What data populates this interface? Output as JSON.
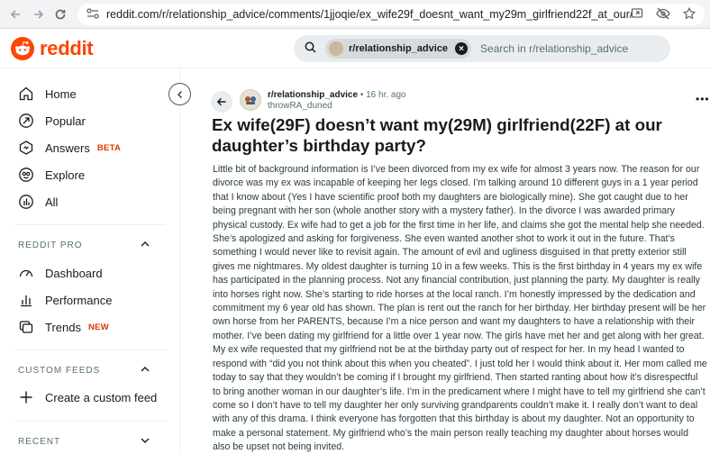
{
  "browser": {
    "url": "reddit.com/r/relationship_advice/comments/1jjoqie/ex_wife29f_doesnt_want_my29m_girlfriend22f_at_our/"
  },
  "header": {
    "logo_text": "reddit",
    "brand_color": "#ff4500",
    "search": {
      "chip_label": "r/relationship_advice",
      "placeholder": "Search in r/relationship_advice"
    }
  },
  "sidebar": {
    "main_items": [
      {
        "label": "Home",
        "icon": "home-icon"
      },
      {
        "label": "Popular",
        "icon": "popular-icon"
      },
      {
        "label": "Answers",
        "icon": "answers-icon",
        "tag": "BETA"
      },
      {
        "label": "Explore",
        "icon": "explore-icon"
      },
      {
        "label": "All",
        "icon": "all-icon"
      }
    ],
    "reddit_pro": {
      "title": "REDDIT PRO",
      "items": [
        {
          "label": "Dashboard",
          "icon": "dashboard-icon"
        },
        {
          "label": "Performance",
          "icon": "performance-icon"
        },
        {
          "label": "Trends",
          "icon": "trends-icon",
          "tag": "NEW"
        }
      ]
    },
    "custom_feeds": {
      "title": "CUSTOM FEEDS",
      "items": [
        {
          "label": "Create a custom feed",
          "icon": "plus-icon"
        }
      ]
    },
    "recent": {
      "title": "RECENT"
    }
  },
  "post": {
    "subreddit": "r/relationship_advice",
    "age": "• 16 hr. ago",
    "author": "throwRA_duned",
    "title": "Ex wife(29F) doesn’t want my(29M) girlfriend(22F) at our daughter’s birthday party?",
    "body": "Little bit of background information is I’ve been divorced from my ex wife for almost 3 years now. The reason for our divorce was my ex was incapable of keeping her legs closed. I’m talking around 10 different guys in a 1 year period that I know about (Yes I have scientific proof both my daughters are biologically mine). She got caught due to her being pregnant with her son (whole another story with a mystery father). In the divorce I was awarded primary physical custody. Ex wife had to get a job for the first time in her life, and claims she got the mental help she needed. She’s apologized and asking for forgiveness. She even wanted another shot to work it out in the future. That’s something I would never like to revisit again. The amount of evil and ugliness disguised in that pretty exterior still gives me nightmares. My oldest daughter is turning 10 in a few weeks. This is the first birthday in 4 years my ex wife has participated in the planning process. Not any financial contribution, just planning the party. My daughter is really into horses right now. She’s starting to ride horses at the local ranch. I’m honestly impressed by the dedication and commitment my 6 year old has shown. The plan is rent out the ranch for her birthday. Her birthday present will be her own horse from her PARENTS, because I’m a nice person and want my daughters to have a relationship with their mother. I’ve been dating my girlfriend for a little over 1 year now. The girls have met her and get along with her great. My ex wife requested that my girlfriend not be at the birthday party out of respect for her. In my head I wanted to respond with “did you not think about this when you cheated”. I just told her I would think about it. Her mom called me today to say that they wouldn’t be coming if I brought my girlfriend. Then started ranting about how it’s disrespectful to bring another woman in our daughter’s life. I’m in the predicament where I might have to tell my girlfriend she can’t come so I don’t have to tell my daughter her only surviving grandparents couldn’t make it. I really don’t want to deal with any of this drama. I think everyone has forgotten that this birthday is about my daughter. Not an opportunity to make a personal statement. My girlfriend who’s the main person really teaching my daughter about horses would also be upset not being invited."
  }
}
